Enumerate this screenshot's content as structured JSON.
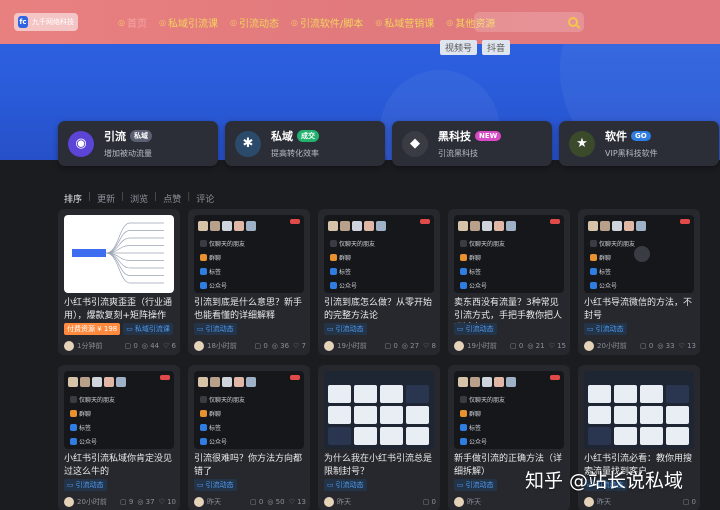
{
  "header": {
    "logo_text": "九千网络科技",
    "nav": [
      {
        "label": "首页",
        "icon": "home-icon",
        "active": true
      },
      {
        "label": "私域引流课",
        "icon": "course-icon"
      },
      {
        "label": "引流动态",
        "icon": "trend-icon"
      },
      {
        "label": "引流软件/脚本",
        "icon": "software-icon"
      },
      {
        "label": "私域营销课",
        "icon": "marketing-icon"
      },
      {
        "label": "其他资源",
        "icon": "resource-icon"
      }
    ],
    "search_placeholder": ""
  },
  "hero": {
    "tags": [
      "视频号",
      "抖音"
    ]
  },
  "categories": [
    {
      "title": "引流",
      "badge": "私域",
      "badge_color": "#5a5f72",
      "desc": "增加被动流量",
      "icon": "globe-icon",
      "icon_color": "#5b44d6"
    },
    {
      "title": "私域",
      "badge": "成交",
      "badge_color": "#23b26d",
      "desc": "提高转化效率",
      "icon": "gear-icon",
      "icon_color": "#2c4a6a"
    },
    {
      "title": "黑科技",
      "badge": "NEW",
      "badge_color": "#d94ac7",
      "desc": "引流黑科技",
      "icon": "hacker-icon",
      "icon_color": "#3a3c44"
    },
    {
      "title": "软件",
      "badge": "GO",
      "badge_color": "#2f7de1",
      "desc": "VIP黑科技软件",
      "icon": "star-icon",
      "icon_color": "#3a4a2a"
    }
  ],
  "sort": {
    "label": "排序",
    "options": [
      "更新",
      "浏览",
      "点赞",
      "评论"
    ]
  },
  "posts_row1": [
    {
      "title": "小红书引流爽歪歪（行业通用），爆款复刻+矩阵操作+…",
      "badges": [
        "付费资源 ¥ 198",
        "私域引流课"
      ],
      "time": "1分钟前",
      "comments": "0",
      "views": "44",
      "likes": "6",
      "thumb": "mind"
    },
    {
      "title": "引流到底是什么意思？新手也能看懂的详细解释",
      "badges": [
        "引流动态"
      ],
      "time": "18小时前",
      "comments": "0",
      "views": "36",
      "likes": "7",
      "thumb": "dark"
    },
    {
      "title": "引流到底怎么做？从零开始的完整方法论",
      "badges": [
        "引流动态"
      ],
      "time": "19小时前",
      "comments": "0",
      "views": "27",
      "likes": "8",
      "thumb": "dark"
    },
    {
      "title": "卖东西没有流量？3种常见引流方式，手把手教你把人吸过来",
      "badges": [
        "引流动态"
      ],
      "time": "19小时前",
      "comments": "0",
      "views": "21",
      "likes": "15",
      "thumb": "dark"
    },
    {
      "title": "小红书导流微信的方法，不封号",
      "badges": [
        "引流动态"
      ],
      "time": "20小时前",
      "comments": "0",
      "views": "33",
      "likes": "13",
      "thumb": "dark"
    }
  ],
  "posts_row2": [
    {
      "title": "小红书引流私域你肯定没见过这么牛的",
      "badges": [
        "引流动态"
      ],
      "time": "20小时前",
      "comments": "9",
      "views": "37",
      "likes": "10",
      "thumb": "dark"
    },
    {
      "title": "引流很难吗？你方法方向都错了",
      "badges": [
        "引流动态"
      ],
      "time": "昨天",
      "comments": "0",
      "views": "50",
      "likes": "13",
      "thumb": "dark"
    },
    {
      "title": "为什么我在小红书引流总是限制封号？",
      "badges": [
        "引流动态"
      ],
      "time": "昨天",
      "comments": "0",
      "views": "",
      "likes": "",
      "thumb": "grid"
    },
    {
      "title": "新手做引流的正确方法（详细拆解）",
      "badges": [
        "引流动态"
      ],
      "time": "昨天",
      "comments": "",
      "views": "",
      "likes": "",
      "thumb": "dark2"
    },
    {
      "title": "小红书引流必看：教你用搜索流量找到客户",
      "badges": [
        "引流动态"
      ],
      "time": "昨天",
      "comments": "0",
      "views": "",
      "likes": "",
      "thumb": "grid"
    }
  ],
  "thumb_labels": {
    "friends": "仅聊天的朋友",
    "cat1": "群聊",
    "cat2": "标签",
    "cat3": "公众号"
  },
  "watermark": "知乎 @站长说私域"
}
